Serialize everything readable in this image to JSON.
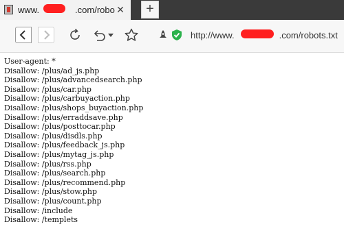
{
  "tab": {
    "title": "www.    .com/robo",
    "close_glyph": "✕",
    "favicon_icon": "page-favicon-icon",
    "redact_color": "#ff1f1f"
  },
  "new_tab": {
    "glyph": "+"
  },
  "toolbar": {
    "back_icon": "chevron-left-icon",
    "forward_icon": "chevron-right-icon",
    "refresh_icon": "refresh-icon",
    "undo_icon": "undo-icon",
    "star_icon": "star-icon",
    "rocket_icon": "rocket-icon",
    "shield_icon": "shield-check-icon",
    "shield_color": "#2bb24c",
    "url": "http://www.     .com/robots.txt"
  },
  "robots": {
    "lines": [
      "User-agent: *",
      "Disallow: /plus/ad_js.php",
      "Disallow: /plus/advancedsearch.php",
      "Disallow: /plus/car.php",
      "Disallow: /plus/carbuyaction.php",
      "Disallow: /plus/shops_buyaction.php",
      "Disallow: /plus/erraddsave.php",
      "Disallow: /plus/posttocar.php",
      "Disallow: /plus/disdls.php",
      "Disallow: /plus/feedback_js.php",
      "Disallow: /plus/mytag_js.php",
      "Disallow: /plus/rss.php",
      "Disallow: /plus/search.php",
      "Disallow: /plus/recommend.php",
      "Disallow: /plus/stow.php",
      "Disallow: /plus/count.php",
      "Disallow: /include",
      "Disallow: /templets"
    ]
  }
}
